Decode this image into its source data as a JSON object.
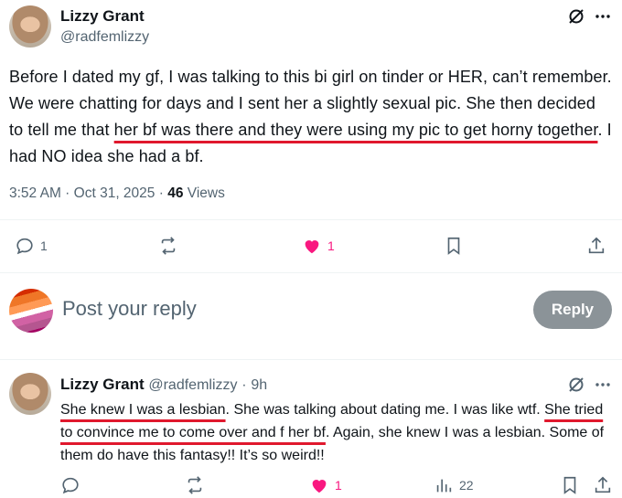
{
  "tweet": {
    "author_name": "Lizzy Grant",
    "author_handle": "@radfemlizzy",
    "text_plain_1": "Before I dated my gf, I was talking to this bi girl on tinder or HER, can’t remember. We were chatting for days and I sent her a slightly sexual pic. She then decided to tell me that ",
    "text_highlight": "her bf was there and they were using my pic to get horny together",
    "text_plain_2": ". I had NO idea she had a bf.",
    "time": "3:52 AM",
    "date": "Oct 31, 2025",
    "views_count": "46",
    "views_label": "Views",
    "replies": "1",
    "likes": "1"
  },
  "composer": {
    "placeholder": "Post your reply",
    "button_label": "Reply"
  },
  "reply": {
    "author_name": "Lizzy Grant",
    "author_handle": "@radfemlizzy",
    "separator": "·",
    "age": "9h",
    "text_highlight_1": "She knew I was a lesbian",
    "text_plain_1": ". She was talking about dating me. I was like wtf. ",
    "text_highlight_2": "She tried to convince me to come over and f her bf",
    "text_plain_2": ". Again, she knew I was a lesbian. Some of them do have this fantasy!! It’s so weird!!",
    "likes": "1",
    "views": "22"
  },
  "colors": {
    "like": "#f91880",
    "underline": "#e0182d",
    "muted": "#536471",
    "reply_button": "#8b9398"
  }
}
